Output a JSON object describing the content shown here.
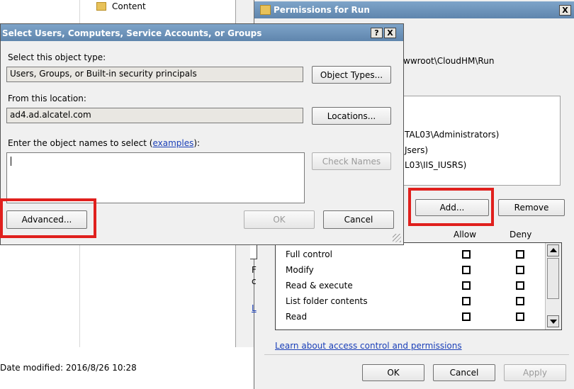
{
  "background": {
    "tree_item": "Content",
    "status": "Date modified: 2016/8/26 10:28"
  },
  "permissions": {
    "title": "Permissions for Run",
    "object_path_fragment": "wwroot\\CloudHM\\Run",
    "principals": [
      "TAL03\\Administrators)",
      "Jsers)",
      "L03\\IIS_IUSRS)"
    ],
    "add_label": "Add...",
    "remove_label": "Remove",
    "allow_header": "Allow",
    "deny_header": "Deny",
    "rows": [
      {
        "label": "Full control"
      },
      {
        "label": "Modify"
      },
      {
        "label": "Read & execute"
      },
      {
        "label": "List folder contents"
      },
      {
        "label": "Read"
      }
    ],
    "link_label": "Learn about access control and permissions",
    "ok_label": "OK",
    "cancel_label": "Cancel",
    "apply_label": "Apply",
    "left_fragments": [
      "F",
      "c",
      "L"
    ]
  },
  "select": {
    "title": "Select Users, Computers, Service Accounts, or Groups",
    "object_type_label": "Select this object type:",
    "object_type_value": "Users, Groups, or Built-in security principals",
    "object_types_button": "Object Types...",
    "location_label": "From this location:",
    "location_value": "ad4.ad.alcatel.com",
    "locations_button": "Locations...",
    "enter_label_prefix": "Enter the object names to select (",
    "enter_label_link": "examples",
    "enter_label_suffix": "):",
    "check_names_button": "Check Names",
    "advanced_button": "Advanced...",
    "ok_button": "OK",
    "cancel_button": "Cancel",
    "help_glyph": "?",
    "close_glyph": "X"
  },
  "colors": {
    "highlight": "#e0201d",
    "titlebar": "#5f85ad",
    "dialog_face": "#f0f0f0"
  }
}
